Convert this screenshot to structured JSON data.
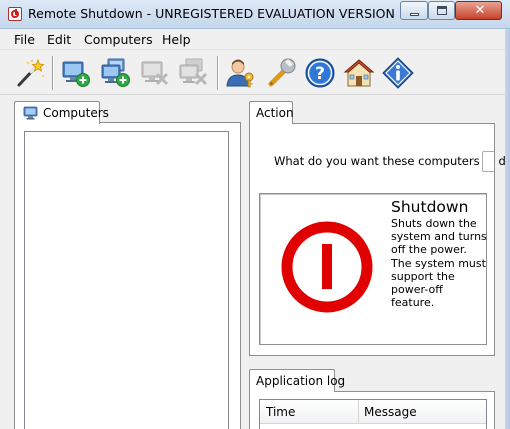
{
  "window": {
    "title": "Remote Shutdown - UNREGISTERED EVALUATION VERSION",
    "close_glyph": "✕"
  },
  "menu": {
    "file": "File",
    "edit": "Edit",
    "computers": "Computers",
    "help": "Help"
  },
  "toolbar": {
    "icons": [
      "magic-wand-icon",
      "add-computer-icon",
      "add-computers-icon",
      "remove-computer-icon",
      "remove-computers-icon",
      "user-key-icon",
      "wrench-icon",
      "help-icon",
      "home-icon",
      "info-icon"
    ],
    "disabled": [
      "remove-computer-icon",
      "remove-computers-icon"
    ]
  },
  "computers_panel": {
    "tab_label": "Computers"
  },
  "action_panel": {
    "tab_label": "Action",
    "question": "What do you want these computers to do:",
    "selected_action": {
      "title": "Shutdown",
      "description": "Shuts down the system and turns off the power. The system must support the power-off feature."
    }
  },
  "log_panel": {
    "tab_label": "Application log",
    "columns": [
      "Time",
      "Message"
    ]
  },
  "colors": {
    "power_red": "#e00000",
    "help_blue": "#1f5fbf"
  }
}
